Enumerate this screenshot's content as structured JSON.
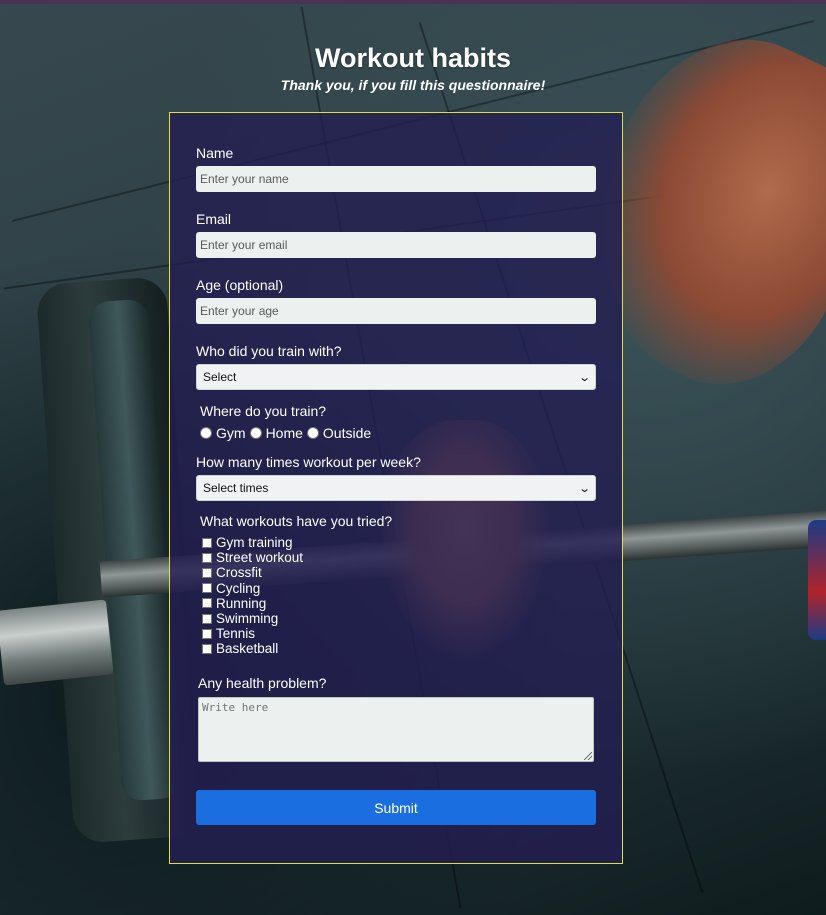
{
  "header": {
    "title": "Workout habits",
    "subtitle": "Thank you, if you fill this questionnaire!"
  },
  "form": {
    "name": {
      "label": "Name",
      "placeholder": "Enter your name"
    },
    "email": {
      "label": "Email",
      "placeholder": "Enter your email"
    },
    "age": {
      "label": "Age (optional)",
      "placeholder": "Enter your age"
    },
    "train_with": {
      "label": "Who did you train with?",
      "selected": "Select"
    },
    "where": {
      "label": "Where do you train?",
      "options": [
        "Gym",
        "Home",
        "Outside"
      ]
    },
    "times": {
      "label": "How many times workout per week?",
      "selected": "Select times"
    },
    "workouts": {
      "label": "What workouts have you tried?",
      "options": [
        "Gym training",
        "Street workout",
        "Crossfit",
        "Cycling",
        "Running",
        "Swimming",
        "Tennis",
        "Basketball"
      ]
    },
    "health": {
      "label": "Any health problem?",
      "placeholder": "Write here"
    },
    "submit_label": "Submit"
  },
  "colors": {
    "form_background": "#231e52",
    "form_border": "#e1df3c",
    "submit_button": "#1a6ee0",
    "top_bar": "#4a3352"
  }
}
